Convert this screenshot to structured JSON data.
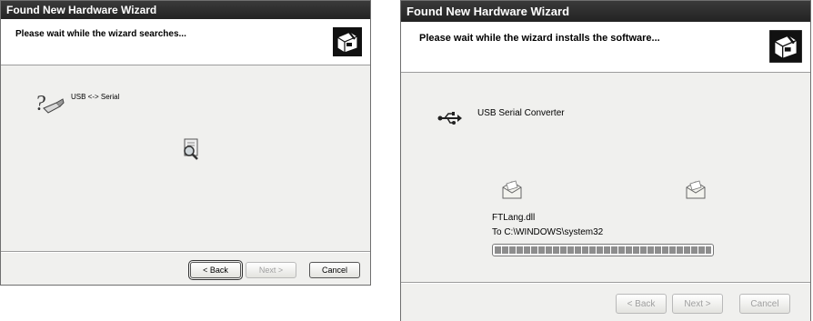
{
  "window_left": {
    "title": "Found New Hardware Wizard",
    "header": "Please wait while the wizard searches...",
    "device": "USB <-> Serial",
    "buttons": {
      "back": "< Back",
      "next": "Next >",
      "cancel": "Cancel"
    }
  },
  "window_right": {
    "title": "Found New Hardware Wizard",
    "header": "Please wait while the wizard installs the software...",
    "device": "USB Serial Converter",
    "file_name": "FTLang.dll",
    "destination": "To C:\\WINDOWS\\system32",
    "progress": 1.0,
    "buttons": {
      "back": "< Back",
      "next": "Next >",
      "cancel": "Cancel"
    }
  }
}
